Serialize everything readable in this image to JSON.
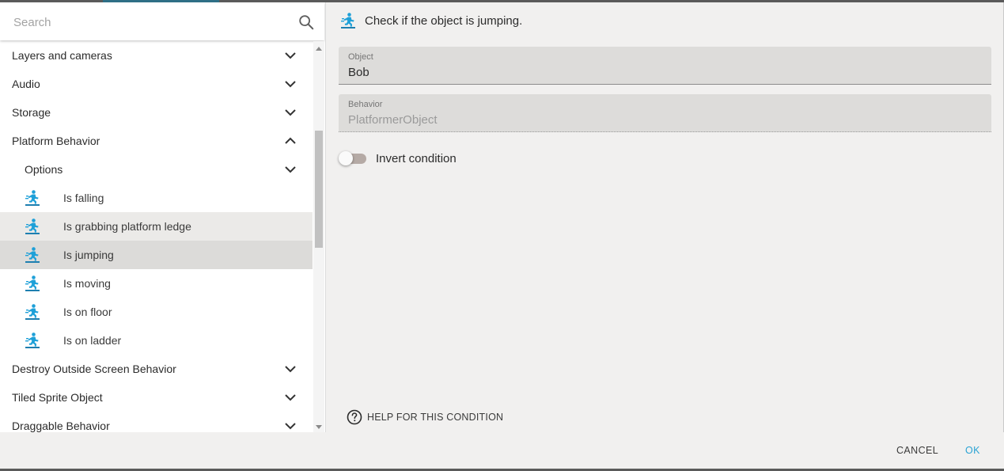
{
  "search": {
    "placeholder": "Search",
    "value": ""
  },
  "sidebar": {
    "groups_top": [
      {
        "label": "Layers and cameras",
        "expanded": false
      },
      {
        "label": "Audio",
        "expanded": false
      },
      {
        "label": "Storage",
        "expanded": false
      },
      {
        "label": "Platform Behavior",
        "expanded": true
      }
    ],
    "subgroup": {
      "label": "Options",
      "expanded": false
    },
    "items": [
      {
        "label": "Is falling",
        "icon": "platformer-icon"
      },
      {
        "label": "Is grabbing platform ledge",
        "icon": "platformer-icon"
      },
      {
        "label": "Is jumping",
        "icon": "platformer-icon",
        "selected": true
      },
      {
        "label": "Is moving",
        "icon": "platformer-icon"
      },
      {
        "label": "Is on floor",
        "icon": "platformer-icon"
      },
      {
        "label": "Is on ladder",
        "icon": "platformer-icon"
      }
    ],
    "groups_bottom": [
      {
        "label": "Destroy Outside Screen Behavior",
        "expanded": false
      },
      {
        "label": "Tiled Sprite Object",
        "expanded": false
      },
      {
        "label": "Draggable Behavior",
        "expanded": false
      }
    ]
  },
  "main": {
    "title": "Check if the object is jumping.",
    "object_field": {
      "label": "Object",
      "value": "Bob"
    },
    "behavior_field": {
      "label": "Behavior",
      "value": "PlatformerObject"
    },
    "invert": {
      "label": "Invert condition",
      "checked": false
    },
    "help_label": "HELP FOR THIS CONDITION"
  },
  "footer": {
    "cancel_label": "CANCEL",
    "ok_label": "OK"
  },
  "colors": {
    "accent": "#2aa3d4",
    "icon": "#1ea0d8",
    "selected_row": "#dcdbd9"
  }
}
